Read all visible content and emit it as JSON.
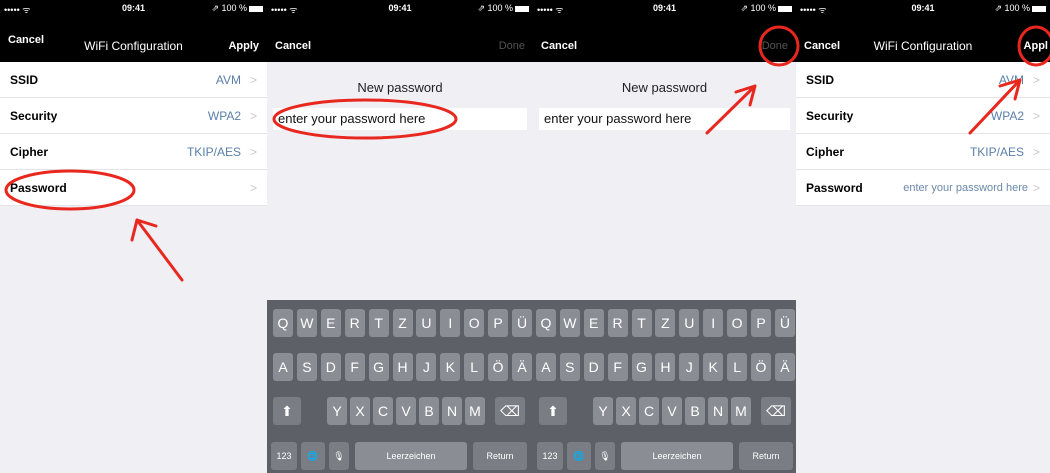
{
  "statusbar": {
    "signal": "••••• ᯤ",
    "time": "09:41",
    "battery": "⇗ 100 %"
  },
  "screen1": {
    "nav": {
      "cancel": "Cancel",
      "title": "WiFi Configuration",
      "apply": "Apply"
    },
    "rows": [
      {
        "label": "SSID",
        "value": "AVM"
      },
      {
        "label": "Security",
        "value": "WPA2"
      },
      {
        "label": "Cipher",
        "value": "TKIP/AES"
      },
      {
        "label": "Password",
        "value": ""
      }
    ]
  },
  "screen2": {
    "nav": {
      "cancel": "Cancel",
      "done": "Done"
    },
    "label": "New password",
    "field_value": "enter your password here"
  },
  "screen3": {
    "nav": {
      "cancel": "Cancel",
      "done": "Done"
    },
    "label": "New password",
    "field_value": "enter your password here"
  },
  "screen4": {
    "nav": {
      "cancel": "Cancel",
      "title": "WiFi Configuration",
      "apply": "Appl"
    },
    "rows": [
      {
        "label": "SSID",
        "value": "AVM"
      },
      {
        "label": "Security",
        "value": "WPA2"
      },
      {
        "label": "Cipher",
        "value": "TKIP/AES"
      },
      {
        "label": "Password",
        "value": "enter your password here"
      }
    ]
  },
  "keyboard": {
    "row1": [
      "Q",
      "W",
      "E",
      "R",
      "T",
      "Z",
      "U",
      "I",
      "O",
      "P",
      "Ü",
      "Q",
      "W",
      "E",
      "R",
      "T",
      "Z",
      "U",
      "I",
      "O",
      "P",
      "Ü"
    ],
    "row2": [
      "A",
      "S",
      "D",
      "F",
      "G",
      "H",
      "J",
      "K",
      "L",
      "Ö",
      "Ä",
      "A",
      "S",
      "D",
      "F",
      "G",
      "H",
      "J",
      "K",
      "L",
      "Ö",
      "Ä"
    ],
    "row3": [
      "Y",
      "X",
      "C",
      "V",
      "B",
      "N",
      "M",
      "Y",
      "X",
      "C",
      "V",
      "B",
      "N",
      "M"
    ],
    "shift": "⬆",
    "backspace": "⌫",
    "num": "123",
    "globe": "🌐",
    "mic": "🎙",
    "space": "Leerzeichen",
    "return": "Return"
  },
  "colors": {
    "annotation": "#e8281e",
    "value": "#5a7fa8",
    "navbar": "#000000"
  }
}
